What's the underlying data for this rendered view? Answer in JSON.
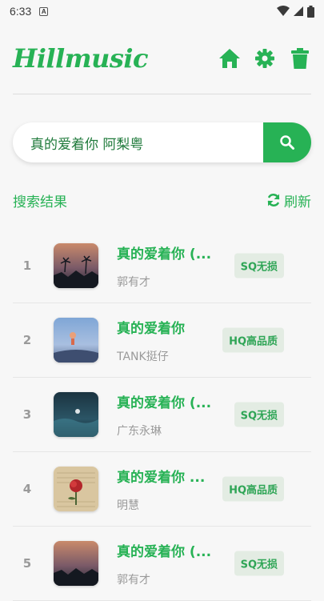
{
  "status_bar": {
    "time": "6:33",
    "notification_glyph": "A"
  },
  "header": {
    "logo_text": "Hillmusic",
    "icons": [
      "home-icon",
      "settings-gear-icon",
      "trash-icon"
    ]
  },
  "search": {
    "query": "真的爱着你 阿梨粤",
    "button_icon": "search-icon"
  },
  "results": {
    "title": "搜索结果",
    "refresh_label": "刷新",
    "items": [
      {
        "index": "1",
        "title": "真的爱着你 (...",
        "artist": "郭有才",
        "quality": "SQ无损"
      },
      {
        "index": "2",
        "title": "真的爱着你",
        "artist": "TANK挺仔",
        "quality": "HQ高品质"
      },
      {
        "index": "3",
        "title": "真的爱着你 (...",
        "artist": "广东永琳",
        "quality": "SQ无损"
      },
      {
        "index": "4",
        "title": "真的爱着你 ...",
        "artist": "明慧",
        "quality": "HQ高品质"
      },
      {
        "index": "5",
        "title": "真的爱着你 (...",
        "artist": "郭有才",
        "quality": "SQ无损"
      }
    ]
  },
  "colors": {
    "accent": "#27b255",
    "badge_bg": "#e3ece3",
    "muted_text": "#9a9a9a"
  }
}
